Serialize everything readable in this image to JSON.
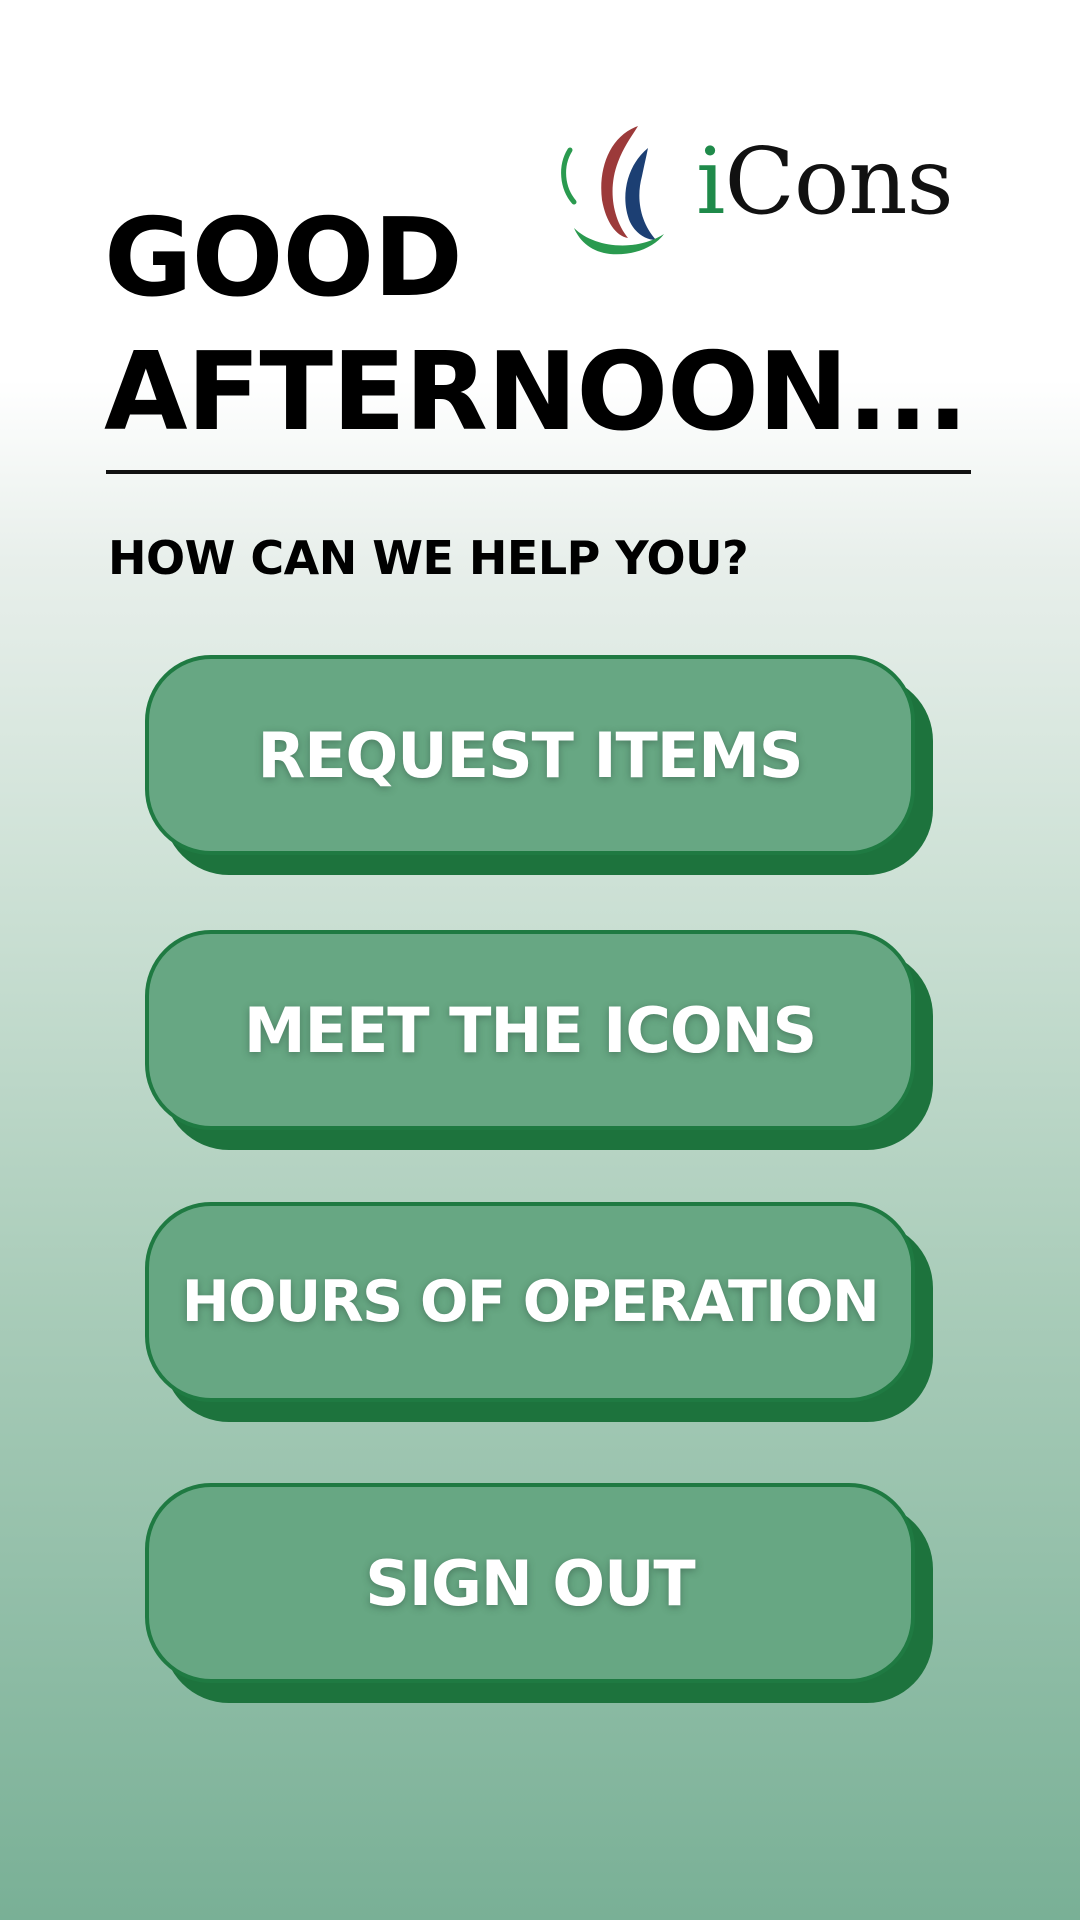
{
  "brand": {
    "logo_name": "iCons",
    "logo_prefix": "i",
    "logo_suffix": "Cons",
    "logo_colors": {
      "red": "#9c3a3a",
      "blue": "#1c3f73",
      "green": "#2a9a4f"
    }
  },
  "greeting": {
    "line1": "GOOD",
    "line2": "AFTERNOON..."
  },
  "prompt": "HOW CAN WE HELP YOU?",
  "menu": [
    {
      "label": "REQUEST ITEMS"
    },
    {
      "label": "MEET THE ICONS"
    },
    {
      "label": "HOURS OF OPERATION"
    },
    {
      "label": "SIGN OUT"
    }
  ],
  "theme": {
    "button_fill": "#67a783",
    "button_border": "#1f7a42",
    "button_shadow": "#1d733d",
    "button_text": "#ffffff",
    "background_top": "#ffffff",
    "background_bottom": "#79b096"
  }
}
